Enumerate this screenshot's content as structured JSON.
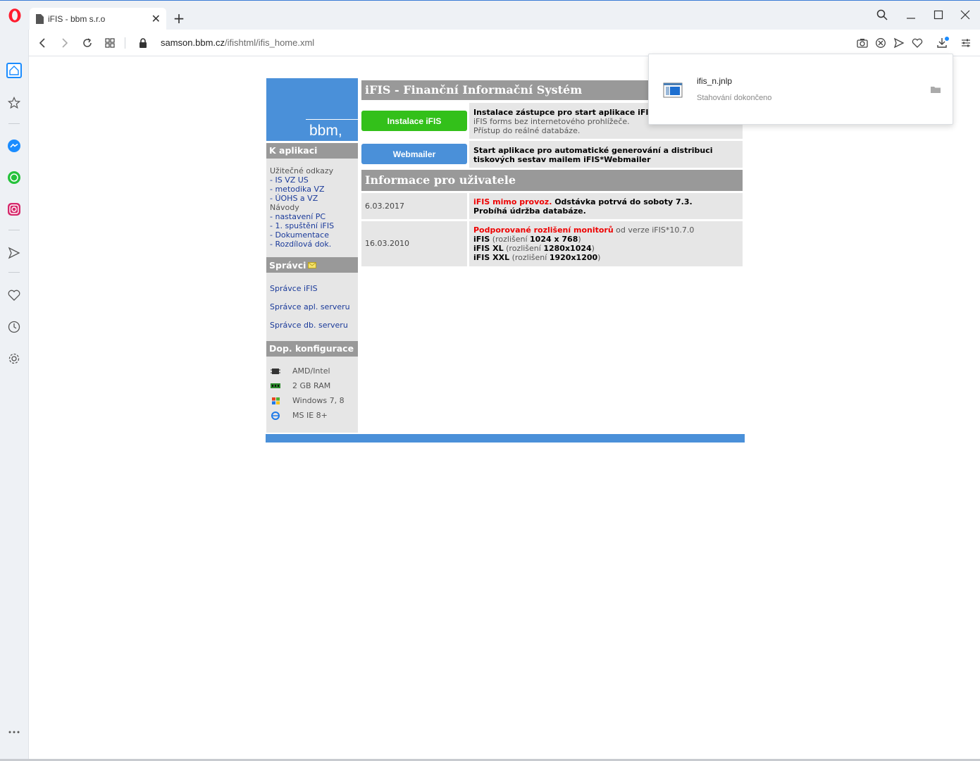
{
  "browser": {
    "tab_title": "iFIS - bbm s.r.o",
    "tab_close": "✕",
    "new_tab": "+",
    "url_host": "samson.bbm.cz",
    "url_path": "/ifishtml/ifis_home.xml"
  },
  "download": {
    "file_name": "ifis_n.jnlp",
    "status": "Stahování dokončeno"
  },
  "page": {
    "logo": "bbm,",
    "title": "iFIS - Finanční Informační Systém",
    "left": {
      "k_aplikaci": "K aplikaci",
      "useful_links_label": "Užitečné odkazy",
      "links": [
        "- IS VZ US",
        "- metodika VZ",
        "- ÚOHS a VZ"
      ],
      "guides_label": "Návody",
      "guides": [
        "- nastavení PC",
        "- 1. spuštění iFIS",
        "- Dokumentace",
        "- Rozdílová dok."
      ],
      "spravci": "Správci",
      "admins": [
        "Správce iFIS",
        "Správce apl. serveru",
        "Správce db. serveru"
      ],
      "dop_konfigurace": "Dop. konfigurace",
      "config": [
        "AMD/Intel",
        "2 GB RAM",
        "Windows 7, 8",
        "MS IE 8+"
      ]
    },
    "apps": {
      "install_button": "Instalace iFIS",
      "install_desc_bold": "Instalace zástupce pro start aplikace iFIS",
      "install_desc_line2": "iFIS forms bez internetového prohlížeče.",
      "install_desc_line3": "Přístup do reálné databáze.",
      "webmailer_button": "Webmailer",
      "webmailer_desc_line1": "Start aplikace pro automatické generování a distribuci",
      "webmailer_desc_line2": "tiskových sestav mailem iFIS*Webmailer"
    },
    "info": {
      "heading": "Informace pro uživatele",
      "items": [
        {
          "date": "6.03.2017",
          "red": "iFIS mimo provoz.",
          "line1_rest": " Odstávka potrvá do soboty 7.3.",
          "line2": "Probíhá údržba databáze."
        },
        {
          "date": "16.03.2010",
          "red": "Podporované rozlišení monitorů",
          "line1_rest": " od verze iFIS*10.7.0",
          "res": [
            {
              "name": "iFIS",
              "label": " (rozlišení ",
              "value": "1024 x 768",
              "close": ")"
            },
            {
              "name": "iFIS XL",
              "label": " (rozlišení ",
              "value": "1280x1024",
              "close": ")"
            },
            {
              "name": "iFIS XXL",
              "label": " (rozlišení ",
              "value": "1920x1200",
              "close": ")"
            }
          ]
        }
      ]
    }
  }
}
